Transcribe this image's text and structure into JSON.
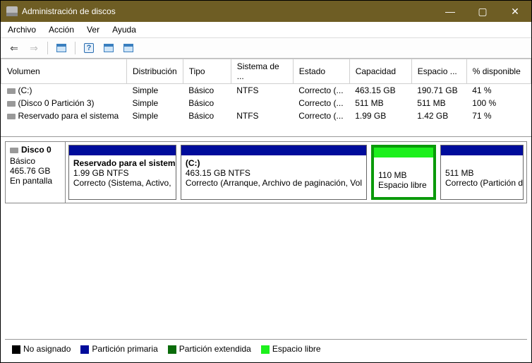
{
  "window": {
    "title": "Administración de discos"
  },
  "menu": {
    "archivo": "Archivo",
    "accion": "Acción",
    "ver": "Ver",
    "ayuda": "Ayuda"
  },
  "columns": {
    "volumen": "Volumen",
    "distribucion": "Distribución",
    "tipo": "Tipo",
    "sistema": "Sistema de ...",
    "estado": "Estado",
    "capacidad": "Capacidad",
    "espacio": "Espacio ...",
    "porcentaje": "% disponible"
  },
  "volumes": [
    {
      "name": "(C:)",
      "dist": "Simple",
      "tipo": "Básico",
      "fs": "NTFS",
      "estado": "Correcto (...",
      "cap": "463.15 GB",
      "free": "190.71 GB",
      "pct": "41 %"
    },
    {
      "name": "(Disco 0 Partición 3)",
      "dist": "Simple",
      "tipo": "Básico",
      "fs": "",
      "estado": "Correcto (...",
      "cap": "511 MB",
      "free": "511 MB",
      "pct": "100 %"
    },
    {
      "name": "Reservado para el sistema",
      "dist": "Simple",
      "tipo": "Básico",
      "fs": "NTFS",
      "estado": "Correcto (...",
      "cap": "1.99 GB",
      "free": "1.42 GB",
      "pct": "71 %"
    }
  ],
  "disk": {
    "label": "Disco 0",
    "type": "Básico",
    "size": "465.76 GB",
    "status": "En pantalla"
  },
  "parts": {
    "p1": {
      "title": "Reservado para el sistem",
      "line2": "1.99 GB NTFS",
      "line3": "Correcto (Sistema, Activo,"
    },
    "p2": {
      "title": "(C:)",
      "line2": "463.15 GB NTFS",
      "line3": "Correcto (Arranque, Archivo de paginación, Vol"
    },
    "p3": {
      "line2": "110 MB",
      "line3": "Espacio libre"
    },
    "p4": {
      "line2": "511 MB",
      "line3": "Correcto (Partición de"
    }
  },
  "legend": {
    "unassigned": "No asignado",
    "primary": "Partición primaria",
    "extended": "Partición extendida",
    "free": "Espacio libre"
  }
}
